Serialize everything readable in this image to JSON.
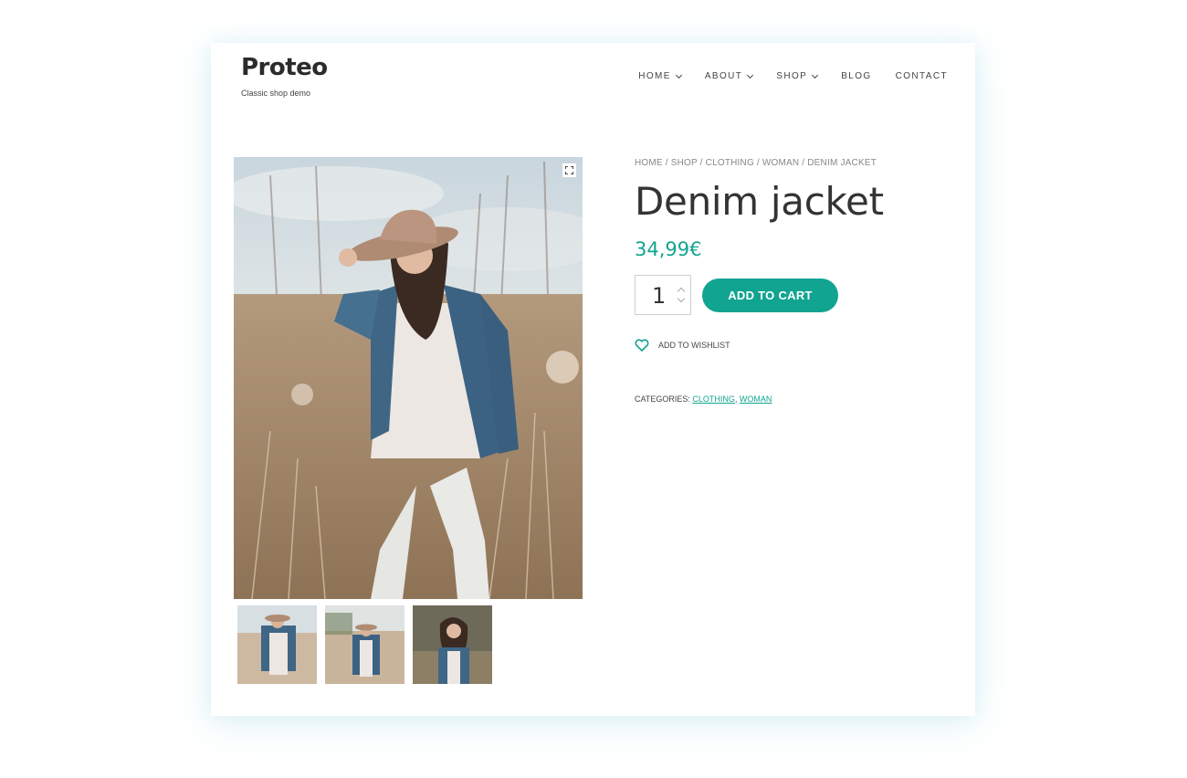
{
  "site": {
    "logo": "Proteo",
    "tagline": "Classic shop demo"
  },
  "nav": [
    {
      "label": "HOME",
      "dropdown": true
    },
    {
      "label": "ABOUT",
      "dropdown": true
    },
    {
      "label": "SHOP",
      "dropdown": true
    },
    {
      "label": "BLOG",
      "dropdown": false
    },
    {
      "label": "CONTACT",
      "dropdown": false
    }
  ],
  "breadcrumb": [
    "HOME",
    "SHOP",
    "CLOTHING",
    "WOMAN",
    "DENIM JACKET"
  ],
  "product": {
    "title": "Denim jacket",
    "price": "34,99€",
    "quantity": "1",
    "add_to_cart": "ADD TO CART",
    "wishlist": "ADD TO WISHLIST",
    "categories_label": "CATEGORIES:",
    "categories": [
      "CLOTHING",
      "WOMAN"
    ]
  },
  "gallery": {
    "thumbnail_count": 3
  },
  "colors": {
    "accent": "#11a490",
    "text": "#333333"
  },
  "icons": {
    "zoom": "expand-icon",
    "wishlist": "heart-icon",
    "nav_dropdown": "chevron-down-icon"
  }
}
